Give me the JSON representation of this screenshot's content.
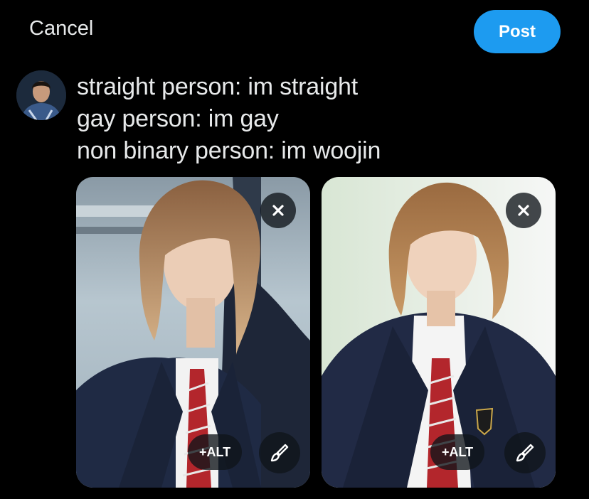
{
  "header": {
    "cancel_label": "Cancel",
    "post_label": "Post"
  },
  "composer": {
    "lines": [
      "straight person: im straight",
      "gay person: im gay",
      "non binary person: im woojin"
    ]
  },
  "media": [
    {
      "alt_label": "+ALT"
    },
    {
      "alt_label": "+ALT"
    }
  ],
  "colors": {
    "accent": "#1d9bf0",
    "background": "#000000",
    "text": "#e7e9ea"
  },
  "icons": {
    "remove": "close-icon",
    "edit": "brush-icon"
  }
}
